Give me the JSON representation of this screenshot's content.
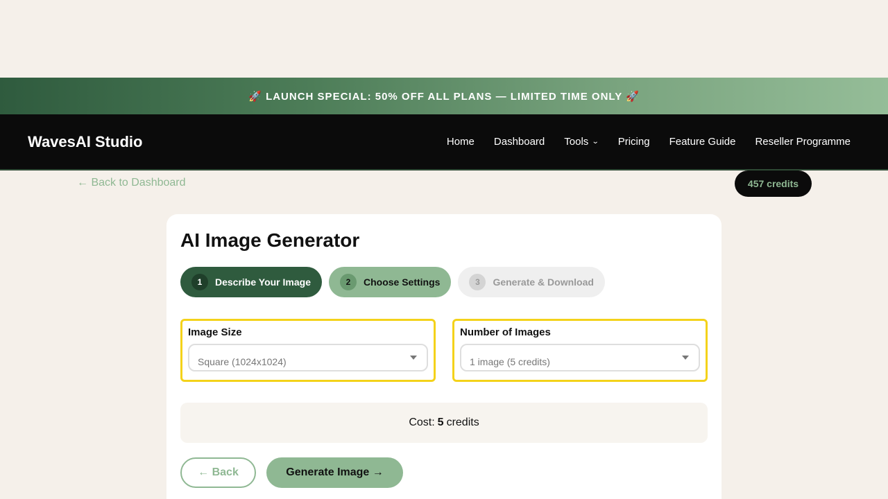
{
  "promo": {
    "text": "🚀 LAUNCH SPECIAL: 50% OFF ALL PLANS — LIMITED TIME ONLY 🚀"
  },
  "nav": {
    "brand": "WavesAI Studio",
    "links": [
      "Home",
      "Dashboard",
      "Tools",
      "Pricing",
      "Feature Guide",
      "Reseller Programme"
    ]
  },
  "subbar": {
    "back_label": "← Back to Dashboard",
    "credits": "457 credits"
  },
  "card": {
    "title": "AI Image Generator",
    "steps": [
      {
        "num": "1",
        "label": "Describe Your Image"
      },
      {
        "num": "2",
        "label": "Choose Settings"
      },
      {
        "num": "3",
        "label": "Generate & Download"
      }
    ],
    "image_size": {
      "label": "Image Size",
      "value": "Square (1024x1024)"
    },
    "num_images": {
      "label": "Number of Images",
      "value": "1 image (5 credits)"
    },
    "cost": {
      "prefix": "Cost:",
      "amount": "5",
      "suffix": "credits"
    },
    "back_button": "← Back",
    "generate_button": "Generate Image →"
  },
  "colors": {
    "accent_dark": "#2f5b3e",
    "accent_light": "#8fb893",
    "highlight": "#f4d21a",
    "nav_bg": "#0b0b0b"
  }
}
